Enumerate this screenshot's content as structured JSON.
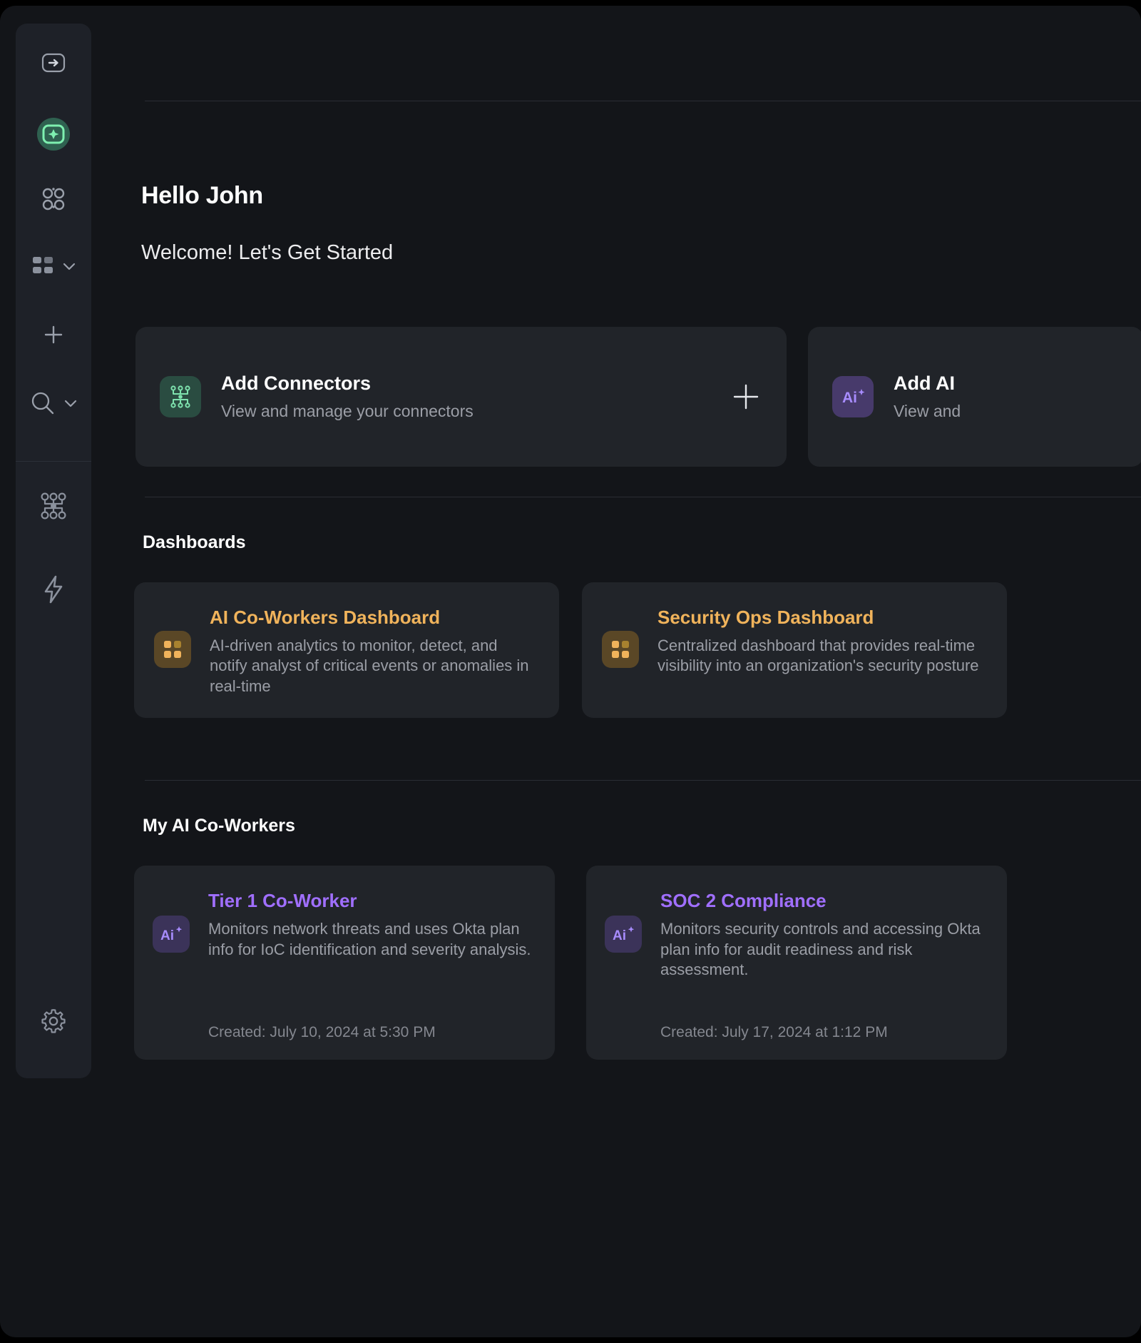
{
  "sidebar": {
    "items": [
      {
        "name": "login-arrow-icon",
        "icon": "arrow-right-in-box",
        "has_chevron": false,
        "active": false
      },
      {
        "name": "ai-sparkle-icon",
        "icon": "sparkle-in-box",
        "has_chevron": false,
        "active": true
      },
      {
        "name": "nodes-icon",
        "icon": "four-circles-nodes",
        "has_chevron": false,
        "active": false
      },
      {
        "name": "dashboard-grid-icon",
        "icon": "grid-four-squares",
        "has_chevron": true,
        "active": false
      },
      {
        "name": "add-icon",
        "icon": "plus",
        "has_chevron": false,
        "active": false
      },
      {
        "name": "search-icon",
        "icon": "magnifier",
        "has_chevron": true,
        "active": false
      },
      {
        "name": "topology-icon",
        "icon": "network-topology",
        "has_chevron": false,
        "active": false
      },
      {
        "name": "automation-icon",
        "icon": "lightning-bolt",
        "has_chevron": false,
        "active": false
      },
      {
        "name": "settings-icon",
        "icon": "gear",
        "has_chevron": false,
        "active": false
      }
    ]
  },
  "header": {
    "greeting": "Hello John",
    "welcome": "Welcome! Let's Get Started"
  },
  "action_cards": [
    {
      "title": "Add Connectors",
      "subtitle": "View and manage your connectors",
      "badge_icon": "connector-chip-icon",
      "badge_color": "#2a4c41",
      "icon_color": "#7ee2ae",
      "action_icon": "plus-icon"
    },
    {
      "title": "Add  AI",
      "subtitle": "View and",
      "badge_icon": "ai-icon",
      "badge_color": "#473a6b",
      "icon_color": "#a06fff"
    }
  ],
  "dashboards": {
    "heading": "Dashboards",
    "cards": [
      {
        "title": "AI Co-Workers Dashboard",
        "description": "AI-driven analytics to monitor, detect, and notify analyst of critical events or anomalies in real-time",
        "badge_icon": "grid-four-squares-icon",
        "accent": "#f0b35b"
      },
      {
        "title": "Security Ops Dashboard",
        "description": "Centralized dashboard that provides real-time visibility into an organization's security posture",
        "badge_icon": "grid-four-squares-icon",
        "accent": "#f0b35b"
      }
    ]
  },
  "coworkers": {
    "heading": "My AI Co-Workers",
    "cards": [
      {
        "title": "Tier 1 Co-Worker",
        "description": "Monitors network threats and uses Okta plan info for IoC identification and severity analysis.",
        "created": "Created: July 10, 2024 at 5:30 PM",
        "badge_icon": "ai-icon",
        "accent": "#a06fff"
      },
      {
        "title": "SOC 2 Compliance",
        "description": "Monitors security controls and accessing Okta plan info for audit readiness and risk assessment.",
        "created": "Created: July 17, 2024 at 1:12 PM",
        "badge_icon": "ai-icon",
        "accent": "#a06fff"
      }
    ]
  },
  "colors": {
    "app_bg": "#131519",
    "sidebar_bg": "#1e2128",
    "card_bg": "#212429",
    "accent_green": "#7ee2ae",
    "accent_amber": "#f0b35b",
    "accent_purple": "#a06fff",
    "muted_text": "#9b9ea6"
  }
}
